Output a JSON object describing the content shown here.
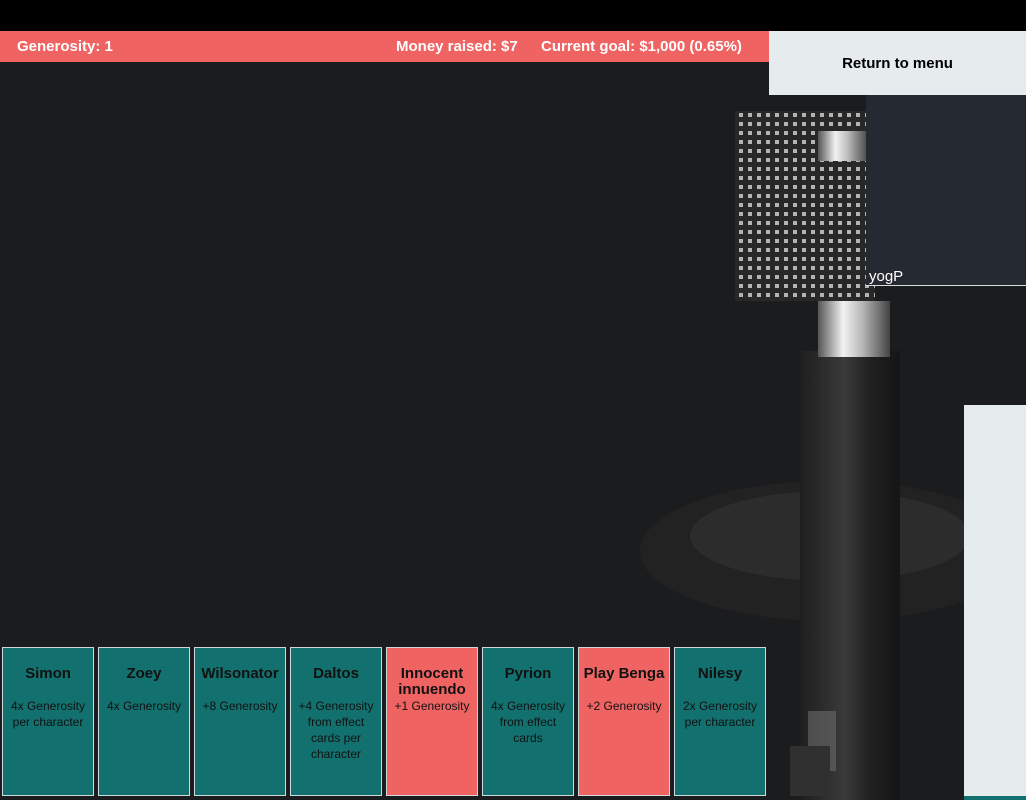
{
  "hud": {
    "generosity": "Generosity: 1",
    "money_raised": "Money raised: $7",
    "current_goal": "Current goal: $1,000 (0.65%)"
  },
  "menu": {
    "return_label": "Return to menu"
  },
  "player": {
    "name": "yogP"
  },
  "cards": [
    {
      "name": "Simon",
      "desc": "4x Generosity per character",
      "color": "teal"
    },
    {
      "name": "Zoey",
      "desc": "4x Generosity",
      "color": "teal"
    },
    {
      "name": "Wilsonator",
      "desc": "+8 Generosity",
      "color": "teal"
    },
    {
      "name": "Daltos",
      "desc": "+4 Generosity from effect cards per character",
      "color": "teal"
    },
    {
      "name": "Innocent innuendo",
      "desc": "+1 Generosity",
      "color": "red"
    },
    {
      "name": "Pyrion",
      "desc": "4x Generosity from effect cards",
      "color": "teal"
    },
    {
      "name": "Play Benga",
      "desc": "+2 Generosity",
      "color": "red"
    },
    {
      "name": "Nilesy",
      "desc": "2x Generosity per character",
      "color": "teal"
    }
  ],
  "colors": {
    "teal": "#12706f",
    "red": "#f06363",
    "panel": "#e6ecee"
  }
}
